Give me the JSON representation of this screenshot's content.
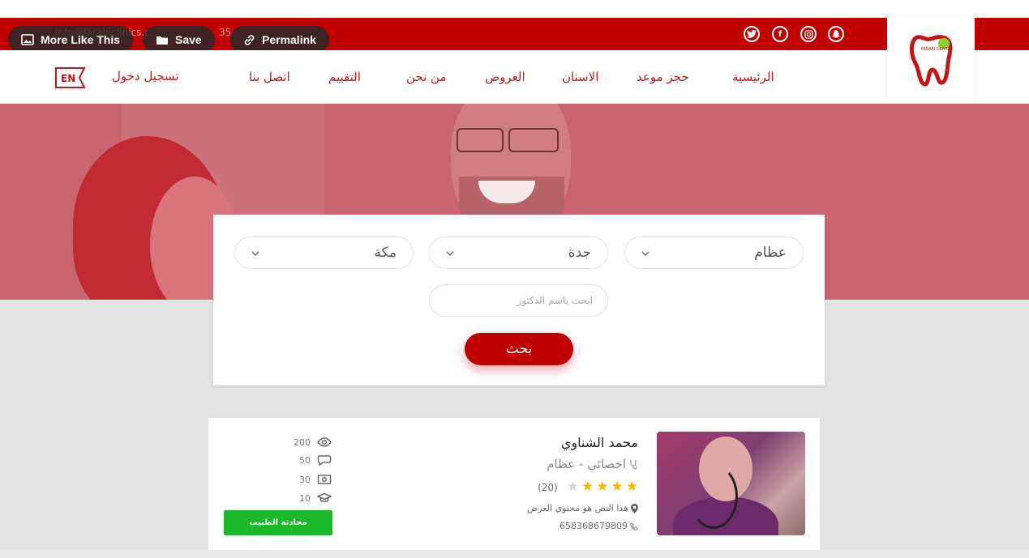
{
  "topbar": {
    "email": "info@farabiclinics.c",
    "phone_fragment": "35",
    "social": [
      "twitter-icon",
      "facebook-icon",
      "instagram-icon",
      "snapchat-icon"
    ]
  },
  "overlay_buttons": {
    "more_like_this": "More Like This",
    "save": "Save",
    "permalink": "Permalink"
  },
  "nav": {
    "items": [
      "الرئيسية",
      "حجز موعد",
      "الاسنان",
      "العروض",
      "من نحن",
      "التقييم",
      "اتصل بنا"
    ],
    "login": "تسجيل دخول",
    "language": "EN"
  },
  "logo": {
    "text": "FARABI DENTAL"
  },
  "search": {
    "specialty": "عظام",
    "city": "جدة",
    "region": "مكة",
    "name_placeholder": "ابحث باسم الدكتور",
    "button": "بحث"
  },
  "doctor": {
    "name": "محمد الشناوي",
    "specialty": "اخصائي - عظام",
    "rating": 4,
    "rating_max": 5,
    "reviews": "(20)",
    "address": "هذا النص هو محتوي العرض",
    "phone": "658368679809",
    "stats": {
      "views": "200",
      "comments": "50",
      "price": "30",
      "experience": "10"
    },
    "chat_button": "محادثة الطبيب"
  },
  "colors": {
    "brand_red": "#c00000",
    "hero_overlay": "#c96570",
    "star": "#f5b800",
    "chat_green": "#1cb82c"
  }
}
